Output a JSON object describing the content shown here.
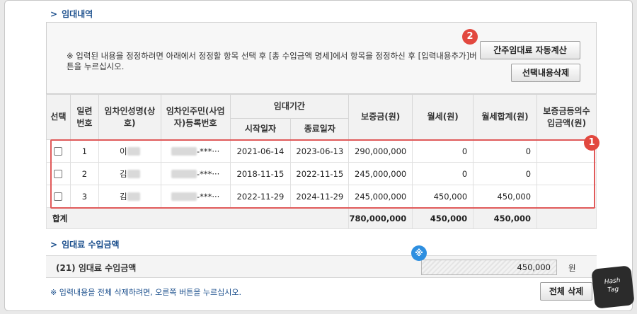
{
  "section1_title": "임대내역",
  "notice_text": "※ 입력된 내용을 정정하려면 아래에서 정정할 항목 선택 후 [총 수입금액 명세]에서 항목을 정정하신 후 [입력내용추가]버튼을 누르십시오.",
  "buttons": {
    "auto_calc": "간주임대료 자동계산",
    "delete_selected": "선택내용삭제",
    "delete_all": "전체 삭제"
  },
  "table": {
    "headers": {
      "select": "선택",
      "serial": "일련번호",
      "tenant_name": "임차인성명(상호)",
      "tenant_id": "임차인주민(사업자)등록번호",
      "period": "임대기간",
      "start": "시작일자",
      "end": "종료일자",
      "deposit": "보증금(원)",
      "monthly": "월세(원)",
      "monthly_total": "월세합계(원)",
      "deposit_income": "보증금등의수입금액(원)"
    },
    "rows": [
      {
        "no": "1",
        "name": "이",
        "id": "-***···",
        "start": "2021-06-14",
        "end": "2023-06-13",
        "deposit": "290,000,000",
        "monthly": "0",
        "monthly_total": "0",
        "income": ""
      },
      {
        "no": "2",
        "name": "김",
        "id": "-***···",
        "start": "2018-11-15",
        "end": "2022-11-15",
        "deposit": "245,000,000",
        "monthly": "0",
        "monthly_total": "0",
        "income": ""
      },
      {
        "no": "3",
        "name": "김",
        "id": "-***···",
        "start": "2022-11-29",
        "end": "2024-11-29",
        "deposit": "245,000,000",
        "monthly": "450,000",
        "monthly_total": "450,000",
        "income": ""
      }
    ],
    "total": {
      "label": "합계",
      "deposit": "780,000,000",
      "monthly": "450,000",
      "monthly_total": "450,000"
    }
  },
  "section2_title": "임대료 수입금액",
  "income": {
    "label": "(21) 임대료 수입금액",
    "value": "450,000",
    "unit": "원"
  },
  "footer_note": "※ 입력내용을 전체 삭제하려면, 오른쪽 버튼을 누르십시오.",
  "badges": {
    "one": "1",
    "two": "2",
    "star": "※"
  },
  "logo_text": {
    "line1": "Hash",
    "line2": "Tag"
  },
  "colors": {
    "accent": "#1a4e8c",
    "highlight": "#e05a5a",
    "badge_blue": "#2e8fe0"
  }
}
